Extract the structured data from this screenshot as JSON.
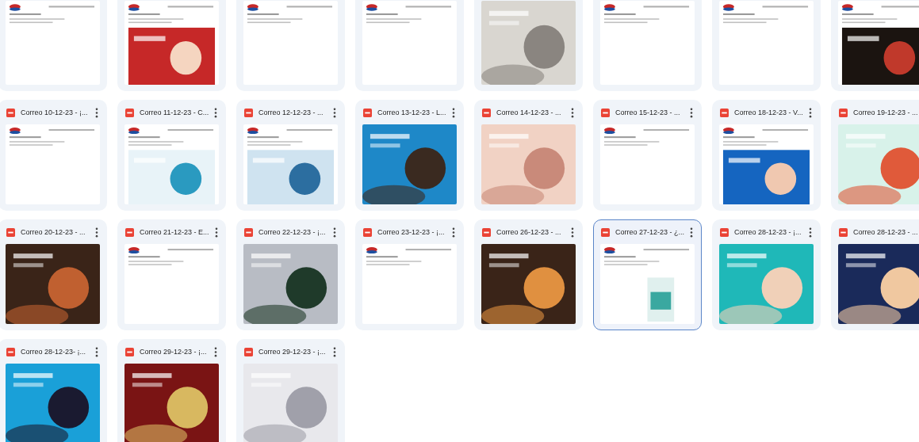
{
  "rows": [
    {
      "items": [
        {
          "selected": false
        },
        {
          "selected": false
        },
        {
          "selected": false
        },
        {
          "selected": false
        },
        {
          "selected": false
        },
        {
          "selected": false
        },
        {
          "selected": false
        },
        {
          "selected": false
        }
      ]
    },
    {
      "items": [
        {
          "title": "Correo 10-12-23 - ¡...",
          "selected": false
        },
        {
          "title": "Correo 11-12-23 - C...",
          "selected": false
        },
        {
          "title": "Correo 12-12-23 - ...",
          "selected": false
        },
        {
          "title": "Correo 13-12-23 - L...",
          "selected": false
        },
        {
          "title": "Correo 14-12-23 - ...",
          "selected": false
        },
        {
          "title": "Correo 15-12-23 - ...",
          "selected": false
        },
        {
          "title": "Correo 18-12-23 - V...",
          "selected": false
        },
        {
          "title": "Correo 19-12-23 - ...",
          "selected": false
        }
      ]
    },
    {
      "items": [
        {
          "title": "Correo 20-12-23 - ...",
          "selected": false
        },
        {
          "title": "Correo 21-12-23 - E...",
          "selected": false
        },
        {
          "title": "Correo 22-12-23 - ¡...",
          "selected": false
        },
        {
          "title": "Correo 23-12-23 - ¡...",
          "selected": false
        },
        {
          "title": "Correo 26-12-23 - ...",
          "selected": false
        },
        {
          "title": "Correo 27-12-23 - ¿...",
          "selected": true
        },
        {
          "title": "Correo 28-12-23 - ¡...",
          "selected": false
        },
        {
          "title": "Correo 28-12-23 - ...",
          "selected": false
        }
      ]
    },
    {
      "items": [
        {
          "title": "Correo 28-12-23- ¡...",
          "selected": false
        },
        {
          "title": "Correo 29-12-23 - ¡...",
          "selected": false
        },
        {
          "title": "Correo 29-12-23 - ¡...",
          "selected": false
        }
      ]
    }
  ]
}
